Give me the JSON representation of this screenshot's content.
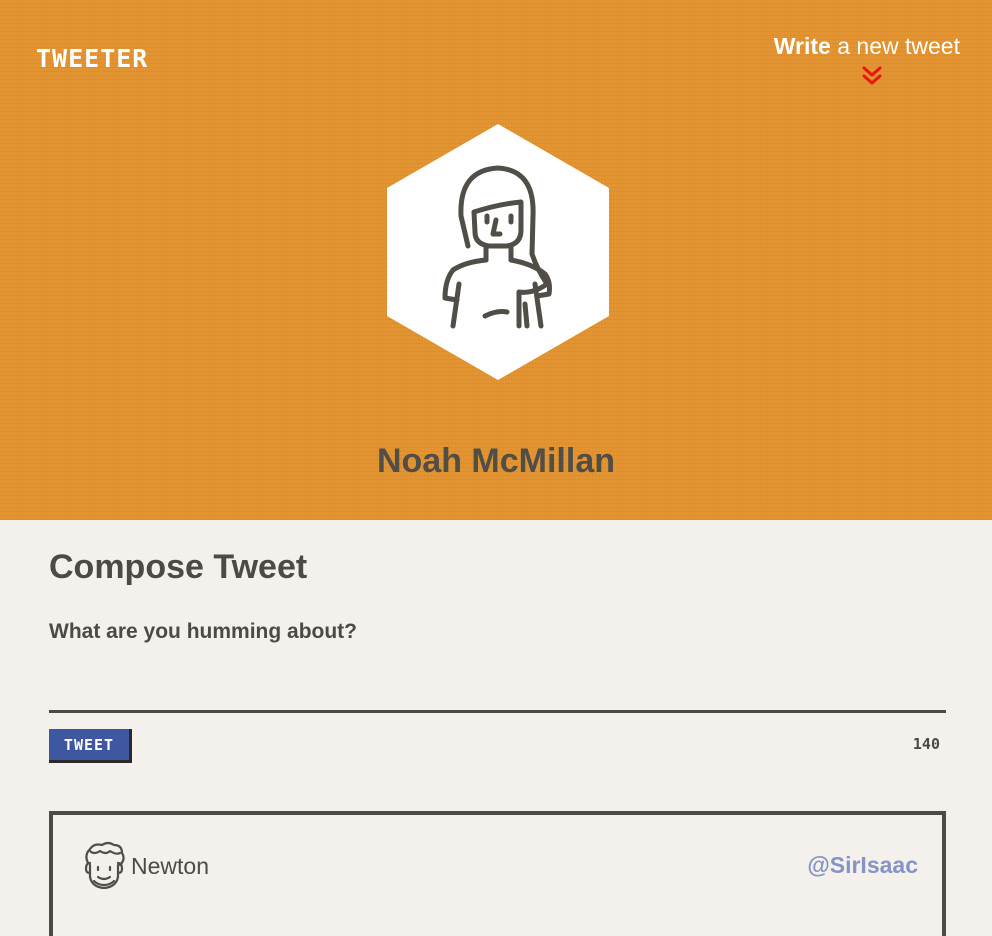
{
  "header": {
    "brand": "TWEETER",
    "write_bold": "Write",
    "write_rest": " a new tweet",
    "profile_name": "Noah McMillan"
  },
  "compose": {
    "title": "Compose Tweet",
    "label": "What are you humming about?",
    "input_value": "",
    "button_label": "TWEET",
    "char_count": "140"
  },
  "tweets": [
    {
      "name": "Newton",
      "handle": "@SirIsaac",
      "content": ""
    }
  ],
  "colors": {
    "header_bg": "#e2922e",
    "page_bg": "#f4f1ec",
    "button_bg": "#3f56a1",
    "handle": "#8593c6",
    "chevron": "#e8160e"
  },
  "icons": {
    "avatar": "woman-avatar-icon",
    "chevron": "double-chevron-down-icon",
    "tweet_avatar": "bearded-man-icon"
  }
}
